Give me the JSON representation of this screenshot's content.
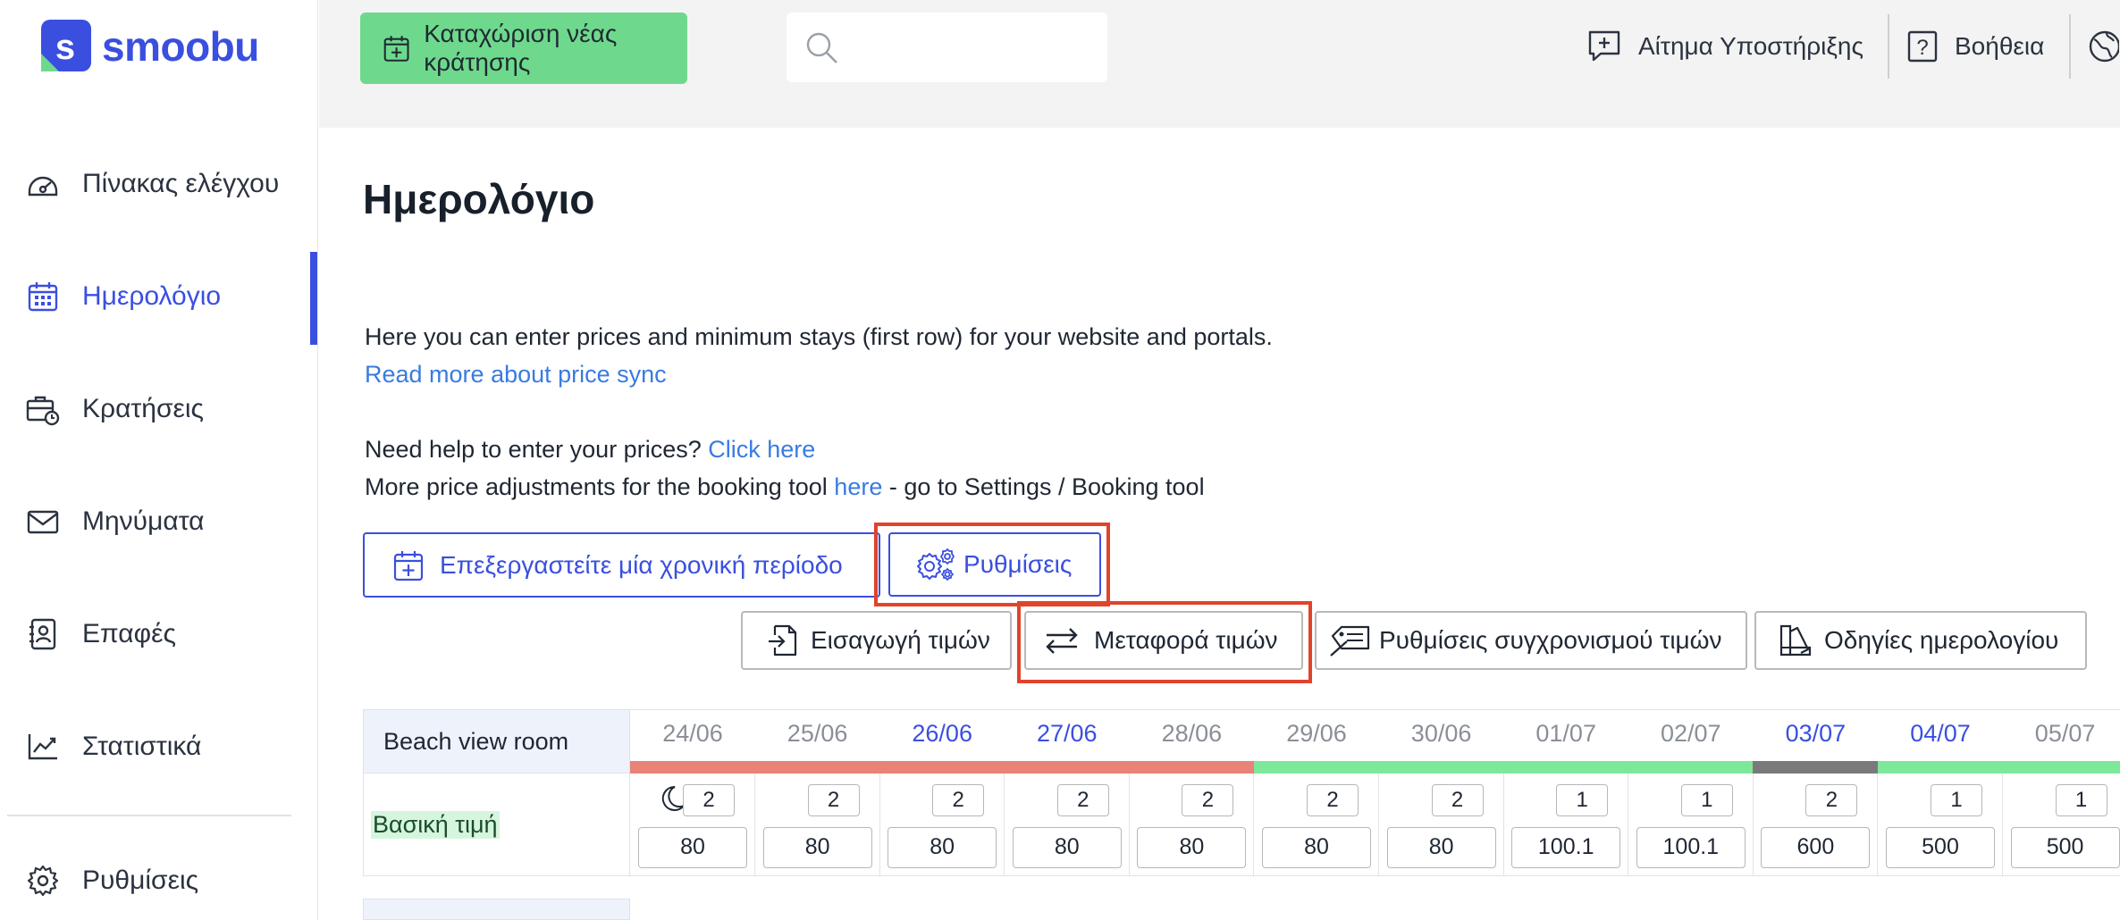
{
  "brand": {
    "name": "smoobu"
  },
  "sidebar": {
    "items": [
      {
        "label": "Πίνακας ελέγχου",
        "icon": "dashboard-icon"
      },
      {
        "label": "Ημερολόγιο",
        "icon": "calendar-icon",
        "active": true
      },
      {
        "label": "Κρατήσεις",
        "icon": "bookings-icon"
      },
      {
        "label": "Μηνύματα",
        "icon": "mail-icon"
      },
      {
        "label": "Επαφές",
        "icon": "contacts-icon"
      },
      {
        "label": "Στατιστικά",
        "icon": "statistics-icon"
      },
      {
        "label": "Ρυθμίσεις",
        "icon": "gear-icon"
      }
    ]
  },
  "topbar": {
    "new_booking_label": "Καταχώριση νέας κράτησης",
    "search_placeholder": "",
    "support_label": "Αίτημα Υποστήριξης",
    "help_label": "Βοήθεια"
  },
  "page": {
    "title": "Ημερολόγιο",
    "intro": "Here you can enter prices and minimum stays (first row) for your website and portals.",
    "read_more_link": "Read more about price sync",
    "need_help_text": "Need help to enter your prices?",
    "click_here_link": "Click here",
    "more_adjust_text": "More price adjustments for the booking tool",
    "here_link": "here",
    "more_adjust_suffix": "- go to Settings / Booking tool"
  },
  "buttons": {
    "edit_period": "Επεξεργαστείτε μία χρονική περίοδο",
    "settings": "Ρυθμίσεις",
    "import_prices": "Εισαγωγή τιμών",
    "transfer_prices": "Μεταφορά τιμών",
    "sync_settings": "Ρυθμίσεις συγχρονισμού τιμών",
    "calendar_guide": "Οδηγίες ημερολογίου"
  },
  "calendar": {
    "room": "Beach view room",
    "rate_label": "Βασική τιμή",
    "days": [
      {
        "date": "24/06",
        "weekend": false,
        "min_stay": "2",
        "price": "80",
        "status": "booked",
        "moon": true
      },
      {
        "date": "25/06",
        "weekend": false,
        "min_stay": "2",
        "price": "80",
        "status": "booked"
      },
      {
        "date": "26/06",
        "weekend": true,
        "min_stay": "2",
        "price": "80",
        "status": "booked"
      },
      {
        "date": "27/06",
        "weekend": true,
        "min_stay": "2",
        "price": "80",
        "status": "booked"
      },
      {
        "date": "28/06",
        "weekend": false,
        "min_stay": "2",
        "price": "80",
        "status": "booked"
      },
      {
        "date": "29/06",
        "weekend": false,
        "min_stay": "2",
        "price": "80",
        "status": "available"
      },
      {
        "date": "30/06",
        "weekend": false,
        "min_stay": "2",
        "price": "80",
        "status": "available"
      },
      {
        "date": "01/07",
        "weekend": false,
        "min_stay": "1",
        "price": "100.1",
        "status": "available"
      },
      {
        "date": "02/07",
        "weekend": false,
        "min_stay": "1",
        "price": "100.1",
        "status": "available"
      },
      {
        "date": "03/07",
        "weekend": true,
        "min_stay": "2",
        "price": "600",
        "status": "blocked"
      },
      {
        "date": "04/07",
        "weekend": true,
        "min_stay": "1",
        "price": "500",
        "status": "available"
      },
      {
        "date": "05/07",
        "weekend": false,
        "min_stay": "1",
        "price": "500",
        "status": "available"
      }
    ],
    "status_colors": {
      "booked": "#e98277",
      "available": "#7ee89a",
      "blocked": "#7a7a7a"
    }
  },
  "colors": {
    "brand": "#3a4fe0",
    "new_booking": "#6ed98d",
    "highlight": "#e0442b"
  }
}
